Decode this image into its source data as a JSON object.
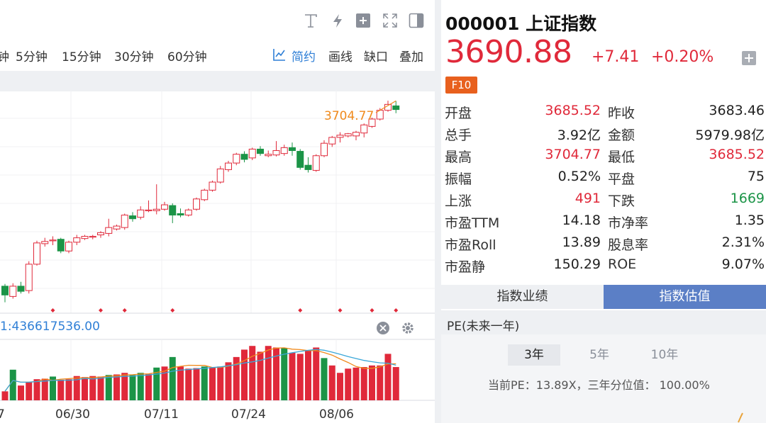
{
  "toolbar": {
    "periods": [
      "钟",
      "5分钟",
      "15分钟",
      "30分钟",
      "60分钟"
    ],
    "actions": {
      "simple": "简约",
      "draw": "画线",
      "gap": "缺口",
      "overlay": "叠加"
    }
  },
  "chart": {
    "max_label": "3704.77",
    "volume_label": "1:436617536.00",
    "x_labels": [
      "7",
      "06/30",
      "07/11",
      "07/24",
      "08/06"
    ]
  },
  "chart_data": {
    "type": "candlestick",
    "candles": [
      [
        3452,
        3440,
        3430,
        3455
      ],
      [
        3438,
        3452,
        3435,
        3456
      ],
      [
        3452,
        3445,
        3442,
        3458
      ],
      [
        3446,
        3482,
        3442,
        3486
      ],
      [
        3482,
        3511,
        3480,
        3514
      ],
      [
        3510,
        3513,
        3506,
        3518
      ],
      [
        3514,
        3515,
        3508,
        3520
      ],
      [
        3516,
        3500,
        3497,
        3518
      ],
      [
        3500,
        3512,
        3497,
        3514
      ],
      [
        3512,
        3518,
        3508,
        3522
      ],
      [
        3517,
        3520,
        3515,
        3522
      ],
      [
        3519,
        3520,
        3516,
        3522
      ],
      [
        3522,
        3525,
        3518,
        3527
      ],
      [
        3524,
        3532,
        3520,
        3544
      ],
      [
        3530,
        3534,
        3528,
        3536
      ],
      [
        3532,
        3549,
        3529,
        3551
      ],
      [
        3548,
        3544,
        3540,
        3553
      ],
      [
        3546,
        3556,
        3543,
        3561
      ],
      [
        3555,
        3556,
        3553,
        3569
      ],
      [
        3555,
        3557,
        3550,
        3591
      ],
      [
        3557,
        3563,
        3555,
        3567
      ],
      [
        3562,
        3549,
        3538,
        3565
      ],
      [
        3551,
        3549,
        3546,
        3558
      ],
      [
        3549,
        3556,
        3547,
        3558
      ],
      [
        3557,
        3571,
        3555,
        3573
      ],
      [
        3570,
        3583,
        3568,
        3585
      ],
      [
        3583,
        3594,
        3581,
        3596
      ],
      [
        3594,
        3612,
        3592,
        3616
      ],
      [
        3611,
        3620,
        3608,
        3623
      ],
      [
        3620,
        3632,
        3617,
        3634
      ],
      [
        3632,
        3625,
        3621,
        3636
      ],
      [
        3627,
        3639,
        3624,
        3641
      ],
      [
        3639,
        3633,
        3630,
        3643
      ],
      [
        3630,
        3632,
        3628,
        3637
      ],
      [
        3631,
        3637,
        3629,
        3650
      ],
      [
        3633,
        3641,
        3630,
        3645
      ],
      [
        3641,
        3637,
        3630,
        3648
      ],
      [
        3636,
        3614,
        3611,
        3639
      ],
      [
        3617,
        3611,
        3607,
        3628
      ],
      [
        3610,
        3630,
        3608,
        3632
      ],
      [
        3630,
        3647,
        3628,
        3651
      ],
      [
        3646,
        3655,
        3642,
        3657
      ],
      [
        3655,
        3658,
        3648,
        3662
      ],
      [
        3657,
        3660,
        3655,
        3661
      ],
      [
        3657,
        3662,
        3651,
        3664
      ],
      [
        3661,
        3672,
        3655,
        3674
      ],
      [
        3670,
        3680,
        3668,
        3682
      ],
      [
        3680,
        3692,
        3678,
        3695
      ],
      [
        3692,
        3700,
        3690,
        3705
      ],
      [
        3698,
        3693,
        3688,
        3704.77
      ]
    ],
    "volumes": [
      [
        "r",
        17
      ],
      [
        "g",
        58
      ],
      [
        "r",
        28
      ],
      [
        "r",
        35
      ],
      [
        "r",
        40
      ],
      [
        "r",
        41
      ],
      [
        "g",
        45
      ],
      [
        "r",
        39
      ],
      [
        "r",
        40
      ],
      [
        "r",
        46
      ],
      [
        "r",
        44
      ],
      [
        "r",
        46
      ],
      [
        "r",
        45
      ],
      [
        "g",
        48
      ],
      [
        "r",
        49
      ],
      [
        "r",
        52
      ],
      [
        "g",
        48
      ],
      [
        "g",
        52
      ],
      [
        "r",
        50
      ],
      [
        "g",
        62
      ],
      [
        "r",
        64
      ],
      [
        "g",
        82
      ],
      [
        "r",
        64
      ],
      [
        "r",
        60
      ],
      [
        "r",
        61
      ],
      [
        "g",
        64
      ],
      [
        "r",
        62
      ],
      [
        "r",
        64
      ],
      [
        "r",
        72
      ],
      [
        "r",
        82
      ],
      [
        "r",
        96
      ],
      [
        "r",
        103
      ],
      [
        "r",
        92
      ],
      [
        "r",
        103
      ],
      [
        "r",
        100
      ],
      [
        "g",
        99
      ],
      [
        "r",
        90
      ],
      [
        "r",
        88
      ],
      [
        "r",
        94
      ],
      [
        "r",
        100
      ],
      [
        "g",
        80
      ],
      [
        "r",
        66
      ],
      [
        "r",
        52
      ],
      [
        "r",
        60
      ],
      [
        "r",
        62
      ],
      [
        "r",
        63
      ],
      [
        "r",
        66
      ],
      [
        "r",
        66
      ],
      [
        "r",
        88
      ],
      [
        "r",
        63
      ]
    ],
    "ma_lines": [
      "ma5",
      "ma10"
    ]
  },
  "quote": {
    "code": "000001",
    "name": "上证指数",
    "price": "3690.88",
    "change": "+7.41",
    "change_pct": "+0.20%",
    "f10": "F10",
    "rows": [
      {
        "l1": "开盘",
        "v1": "3685.52",
        "c1": "red",
        "l2": "昨收",
        "v2": "3683.46",
        "c2": "dark"
      },
      {
        "l1": "总手",
        "v1": "3.92亿",
        "c1": "dark",
        "l2": "金额",
        "v2": "5979.98亿",
        "c2": "dark"
      },
      {
        "l1": "最高",
        "v1": "3704.77",
        "c1": "red",
        "l2": "最低",
        "v2": "3685.52",
        "c2": "red"
      },
      {
        "l1": "振幅",
        "v1": "0.52%",
        "c1": "dark",
        "l2": "平盘",
        "v2": "75",
        "c2": "dark"
      },
      {
        "l1": "上涨",
        "v1": "491",
        "c1": "red",
        "l2": "下跌",
        "v2": "1669",
        "c2": "green"
      },
      {
        "l1": "市盈TTM",
        "v1": "14.18",
        "c1": "dark",
        "l2": "市净率",
        "v2": "1.35",
        "c2": "dark"
      },
      {
        "l1": "市盈Roll",
        "v1": "13.89",
        "c1": "dark",
        "l2": "股息率",
        "v2": "2.31%",
        "c2": "dark"
      },
      {
        "l1": "市盈静",
        "v1": "150.29",
        "c1": "dark",
        "l2": "ROE",
        "v2": "9.07%",
        "c2": "dark"
      }
    ]
  },
  "tabs": {
    "perf": "指数业绩",
    "valuation": "指数估值"
  },
  "pe": {
    "title": "PE(未来一年)",
    "years": [
      "3年",
      "5年",
      "10年"
    ],
    "info": "当前PE：13.89X，三年分位值： 100.00%"
  },
  "colors": {
    "up": "#e0293a",
    "down": "#1b9447",
    "accent": "#2f7fd6",
    "tab_active": "#5b7fc6"
  }
}
